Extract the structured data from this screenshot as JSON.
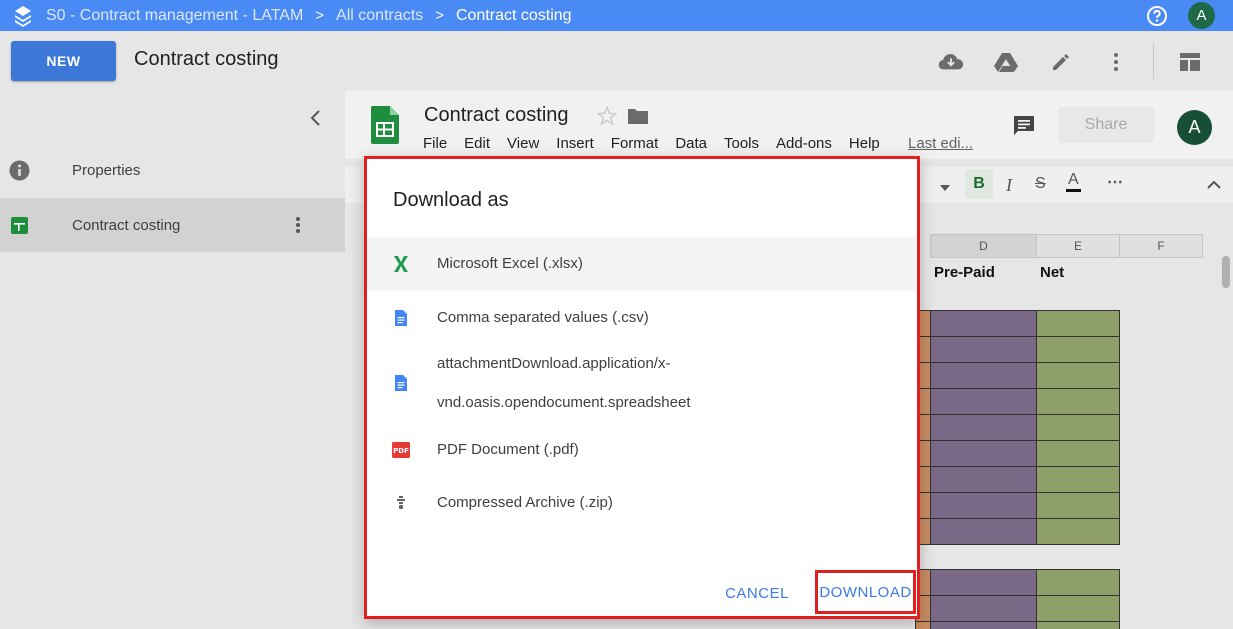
{
  "topbar": {
    "breadcrumbs": [
      "S0 - Contract management - LATAM",
      "All contracts",
      "Contract costing"
    ],
    "separator": ">",
    "avatar_letter": "A",
    "icons": [
      "stacked-layers-logo-icon",
      "help-circle-icon"
    ]
  },
  "toolbar": {
    "new_label": "NEW",
    "title": "Contract costing",
    "icons": [
      "cloud-download-icon",
      "google-drive-icon",
      "pencil-icon",
      "more-vert-icon",
      "layout-icon"
    ]
  },
  "sidebar": {
    "items": [
      {
        "label": "Properties",
        "icon": "info-icon",
        "selected": false
      },
      {
        "label": "Contract costing",
        "icon": "sheets-icon",
        "selected": true
      }
    ]
  },
  "sheet": {
    "title": "Contract costing",
    "menus": [
      "File",
      "Edit",
      "View",
      "Insert",
      "Format",
      "Data",
      "Tools",
      "Add-ons",
      "Help"
    ],
    "last_edit": "Last edi...",
    "share_label": "Share",
    "avatar_letter": "A",
    "format_bold": "B",
    "format_italic": "I",
    "format_strike": "S",
    "format_text_color": "A",
    "format_more": "⋯",
    "columns": [
      "D",
      "E",
      "F"
    ],
    "header_cells": [
      "Pre-Paid",
      "Net"
    ],
    "colors": {
      "prepaid": "#7b6a87",
      "net": "#8f9f6a",
      "orange": "#c98d63"
    }
  },
  "dialog": {
    "title": "Download as",
    "options": [
      {
        "label": "Microsoft Excel (.xlsx)",
        "icon": "excel-x-icon"
      },
      {
        "label": "Comma separated values (.csv)",
        "icon": "document-icon"
      },
      {
        "label_line1": "attachmentDownload.application/x-",
        "label_line2": "vnd.oasis.opendocument.spreadsheet",
        "icon": "document-icon"
      },
      {
        "label": "PDF Document (.pdf)",
        "icon": "pdf-icon"
      },
      {
        "label": "Compressed Archive (.zip)",
        "icon": "zip-icon"
      }
    ],
    "cancel_label": "CANCEL",
    "download_label": "DOWNLOAD",
    "accent": "#3d7be0",
    "highlight": "#e02020"
  }
}
